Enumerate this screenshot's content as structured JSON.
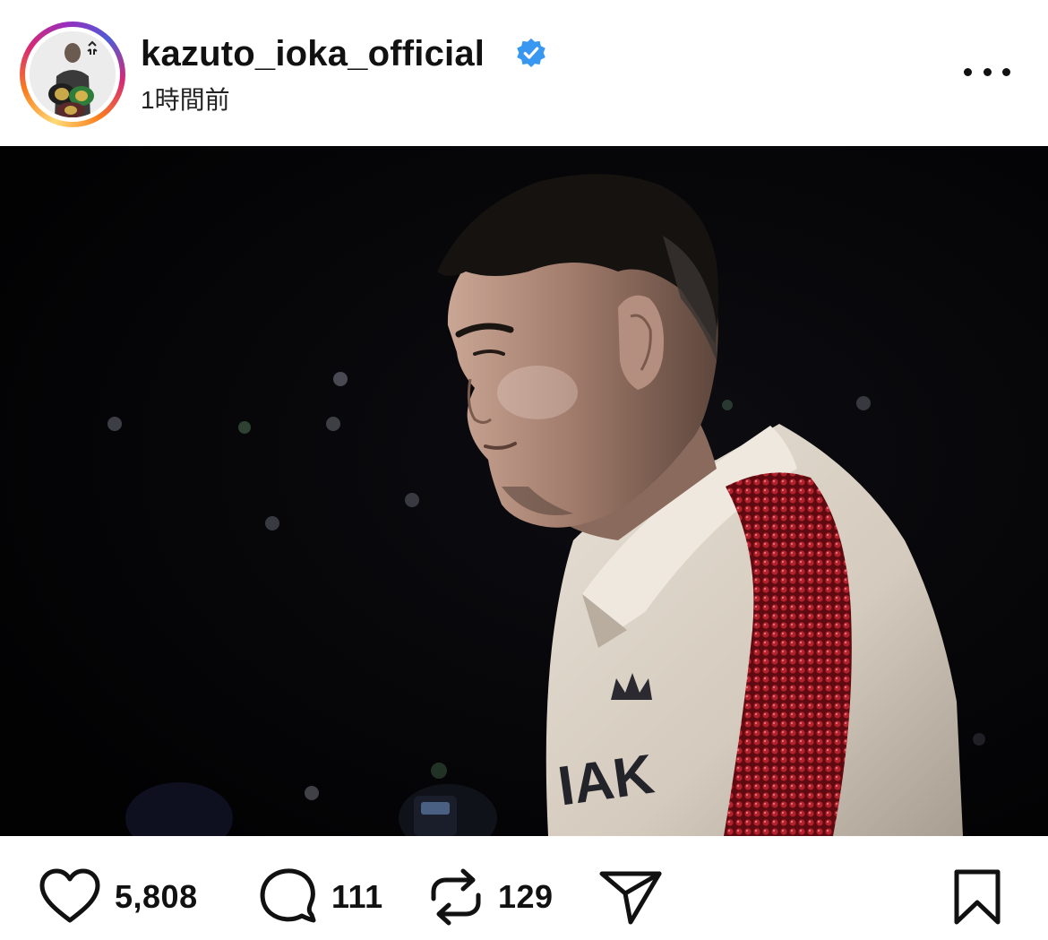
{
  "post": {
    "username": "kazuto_ioka_official",
    "verified": true,
    "timestamp": "1時間前",
    "more_icon": "more-horizontal-icon",
    "photo": {
      "shirt_text": "IAK"
    }
  },
  "actions": {
    "like": {
      "icon": "heart-icon",
      "count": "5,808"
    },
    "comment": {
      "icon": "comment-icon",
      "count": "111"
    },
    "repost": {
      "icon": "repost-icon",
      "count": "129"
    },
    "share": {
      "icon": "send-icon"
    },
    "save": {
      "icon": "bookmark-icon"
    }
  },
  "colors": {
    "verified_badge": "#3897f0",
    "ring_gradient": [
      "#feda75",
      "#fa7e1e",
      "#d62976",
      "#962fbf",
      "#4f5bd5"
    ],
    "photo_background": "#030305"
  }
}
